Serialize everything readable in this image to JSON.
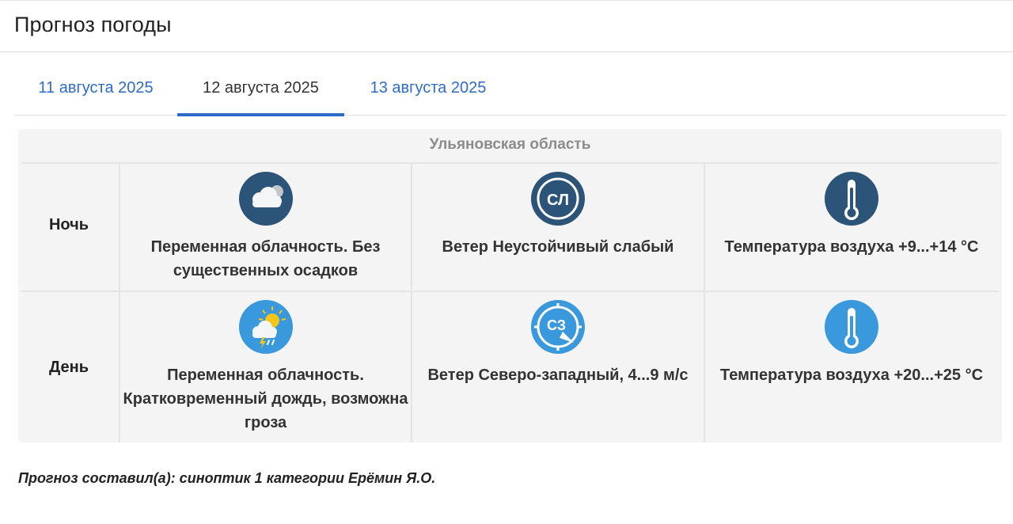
{
  "page": {
    "title": "Прогноз погоды"
  },
  "tabs": [
    {
      "label": "11 августа 2025",
      "active": false
    },
    {
      "label": "12 августа 2025",
      "active": true
    },
    {
      "label": "13 августа 2025",
      "active": false
    }
  ],
  "forecast": {
    "region": "Ульяновская область",
    "rows": [
      {
        "label": "Ночь",
        "sky": {
          "icon": "cloudy-night-icon",
          "text": "Переменная облачность. Без существенных осадков"
        },
        "wind": {
          "icon": "wind-direction-icon",
          "code": "СЛ",
          "text": "Ветер Неустойчивый слабый"
        },
        "temp": {
          "icon": "thermometer-icon",
          "text": "Температура воздуха +9...+14 °C"
        }
      },
      {
        "label": "День",
        "sky": {
          "icon": "sun-cloud-rain-storm-icon",
          "text": "Переменная облачность. Кратковременный дождь, возможна гроза"
        },
        "wind": {
          "icon": "wind-direction-icon",
          "code": "СЗ",
          "text": "Ветер Северо-западный, 4...9 м/с"
        },
        "temp": {
          "icon": "thermometer-icon",
          "text": "Температура воздуха +20...+25 °C"
        }
      }
    ]
  },
  "footer": {
    "text": "Прогноз составил(а): синоптик 1 категории Ерёмин Я.О."
  },
  "colors": {
    "link": "#2f6bc9",
    "night_icon_bg": "#2b5478",
    "day_icon_bg": "#3a98dc",
    "panel_bg": "#f4f4f4"
  }
}
